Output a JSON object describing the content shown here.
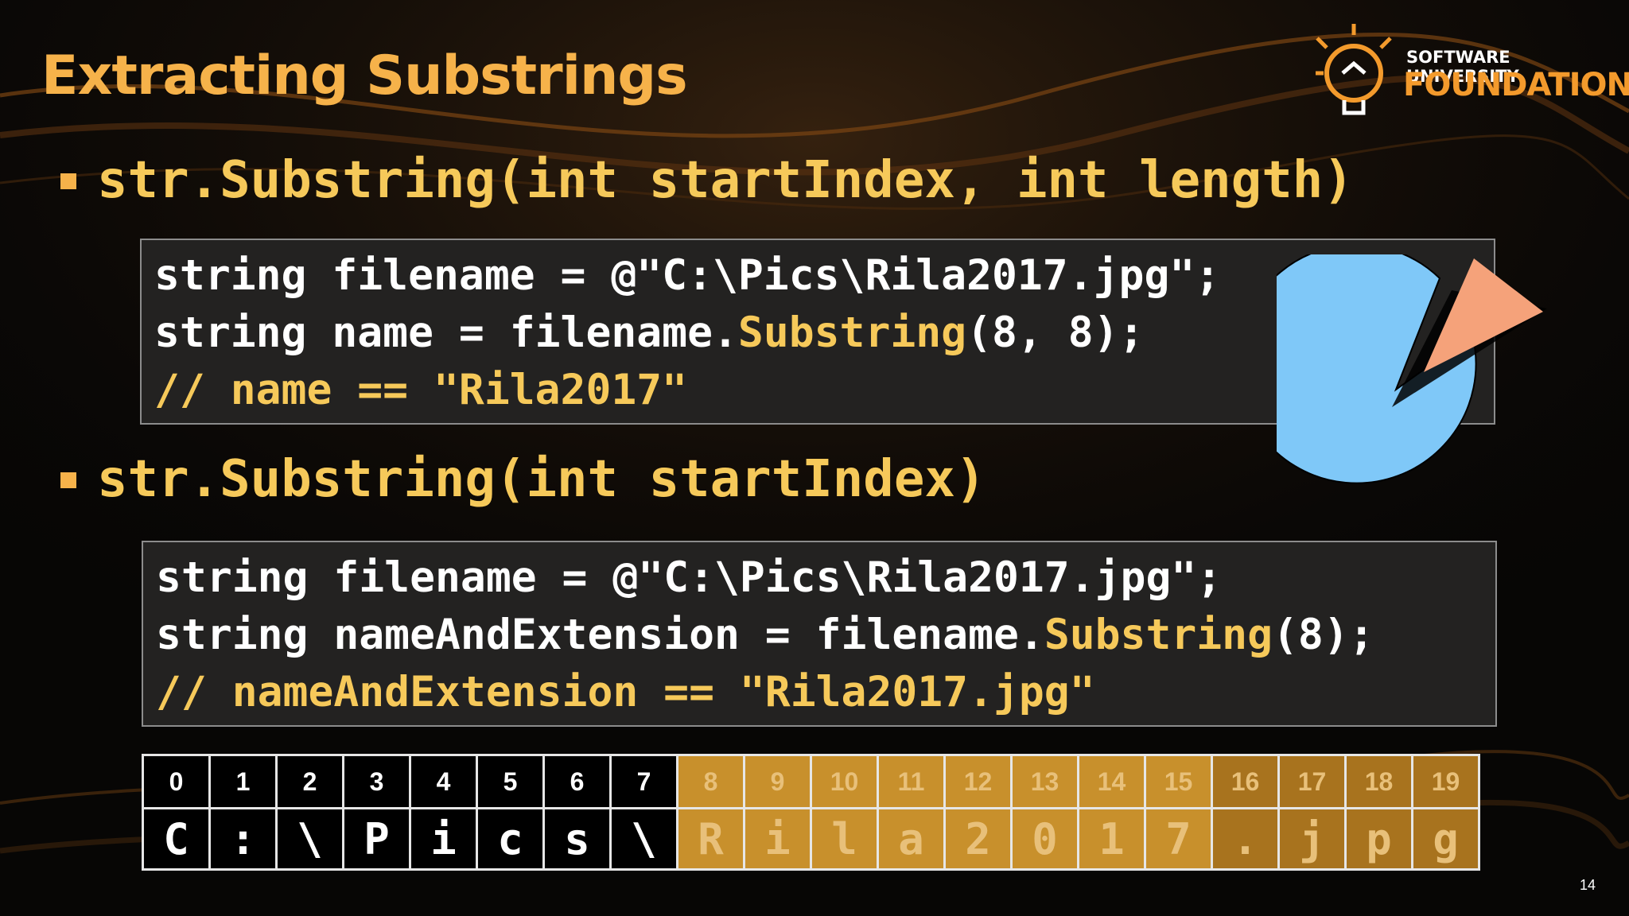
{
  "title": "Extracting Substrings",
  "logo": {
    "line1": "SOFTWARE UNIVERSITY",
    "line2": "FOUNDATION"
  },
  "bullets": [
    {
      "signature": "str.Substring(int startIndex, int length)"
    },
    {
      "signature": "str.Substring(int startIndex)"
    }
  ],
  "code1": {
    "line1": "string filename = @\"C:\\Pics\\Rila2017.jpg\";",
    "line2_pre": "string name = filename.",
    "line2_method": "Substring",
    "line2_post": "(8, 8);",
    "line3": "// name == \"Rila2017\""
  },
  "code2": {
    "line1": "string filename = @\"C:\\Pics\\Rila2017.jpg\";",
    "line2_pre": "string nameAndExtension = filename.",
    "line2_method": "Substring",
    "line2_post": "(8);",
    "line3": "// nameAndExtension == \"Rila2017.jpg\""
  },
  "index_table": {
    "indices": [
      "0",
      "1",
      "2",
      "3",
      "4",
      "5",
      "6",
      "7",
      "8",
      "9",
      "10",
      "11",
      "12",
      "13",
      "14",
      "15",
      "16",
      "17",
      "18",
      "19"
    ],
    "chars": [
      "C",
      ":",
      "\\",
      "P",
      "i",
      "c",
      "s",
      "\\",
      "R",
      "i",
      "l",
      "a",
      "2",
      "0",
      "1",
      "7",
      ".",
      "j",
      "p",
      "g"
    ],
    "highlight_colors": {
      "name": "#c8902c",
      "extension": "#a8731e",
      "default": "#000000"
    }
  },
  "page_number": "14",
  "colors": {
    "accent": "#f6b24a",
    "pie_main": "#7fc8f8",
    "pie_slice": "#f5a27a"
  }
}
